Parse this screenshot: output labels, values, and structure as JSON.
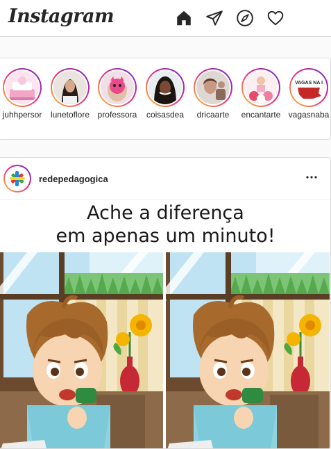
{
  "header": {
    "logo": "Instagram",
    "icons": [
      "home-icon",
      "direct-icon",
      "explore-icon",
      "activity-icon"
    ]
  },
  "stories": [
    {
      "name": "juhhpersor"
    },
    {
      "name": "lunetoflore"
    },
    {
      "name": "professora"
    },
    {
      "name": "coisasdea"
    },
    {
      "name": "dricaarte"
    },
    {
      "name": "encantarte"
    },
    {
      "name": "vagasnaba",
      "avatar_text": "VAGAS NA I"
    }
  ],
  "post": {
    "username": "redepedagogica",
    "headline_line1": "Ache a diferença",
    "headline_line2": "em apenas um minuto!"
  },
  "colors": {
    "ring_start": "#f9ce34",
    "ring_mid": "#ee2a7b",
    "ring_end": "#6228d7",
    "border": "#dbdbdb"
  }
}
